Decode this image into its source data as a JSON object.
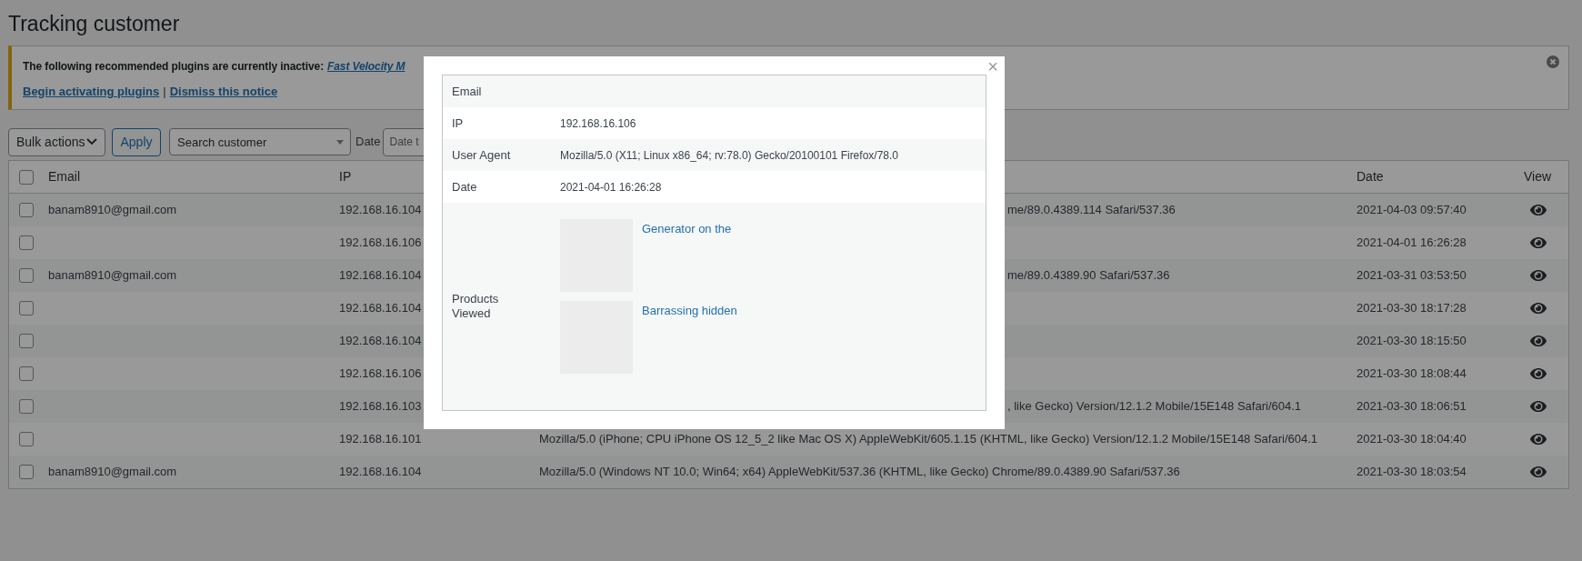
{
  "page_title": "Tracking customer",
  "notice": {
    "text": "The following recommended plugins are currently inactive:",
    "plugin_link": "Fast Velocity M",
    "links": [
      "Begin activating plugins",
      "Dismiss this notice"
    ],
    "separator": "|"
  },
  "toolbar": {
    "bulk_actions": "Bulk actions",
    "apply": "Apply",
    "search": {
      "placeholder": "Search customer"
    },
    "date_label": "Date",
    "date_field": {
      "placeholder": "Date t"
    }
  },
  "table": {
    "select_all_checked": false,
    "columns": {
      "email": "Email",
      "ip": "IP",
      "date": "Date",
      "view": "View"
    },
    "rows": [
      {
        "checked": false,
        "email": "banam8910@gmail.com",
        "ip": "192.168.16.104",
        "user_agent": {
          "kind": "covered",
          "text": "me/89.0.4389.114 Safari/537.36"
        },
        "date": "2021-04-03 09:57:40"
      },
      {
        "checked": false,
        "ip": "192.168.16.106",
        "date": "2021-04-01 16:26:28"
      },
      {
        "checked": false,
        "email": "banam8910@gmail.com",
        "ip": "192.168.16.104",
        "user_agent": {
          "kind": "covered",
          "text": "me/89.0.4389.90 Safari/537.36"
        },
        "date": "2021-03-31 03:53:50"
      },
      {
        "checked": false,
        "ip": "192.168.16.104",
        "date": "2021-03-30 18:17:28"
      },
      {
        "checked": false,
        "ip": "192.168.16.104",
        "date": "2021-03-30 18:15:50"
      },
      {
        "checked": false,
        "ip": "192.168.16.106",
        "date": "2021-03-30 18:08:44"
      },
      {
        "checked": false,
        "ip": "192.168.16.103",
        "user_agent": {
          "kind": "covered",
          "text": ", like Gecko) Version/12.1.2 Mobile/15E148 Safari/604.1"
        },
        "date": "2021-03-30 18:06:51"
      },
      {
        "checked": false,
        "ip": "192.168.16.101",
        "user_agent": {
          "kind": "full",
          "text": "Mozilla/5.0 (iPhone; CPU iPhone OS 12_5_2 like Mac OS X) AppleWebKit/605.1.15 (KHTML, like Gecko) Version/12.1.2 Mobile/15E148 Safari/604.1"
        },
        "date": "2021-03-30 18:04:40"
      },
      {
        "checked": false,
        "email": "banam8910@gmail.com",
        "ip": "192.168.16.104",
        "user_agent": {
          "kind": "full",
          "text": "Mozilla/5.0 (Windows NT 10.0; Win64; x64) AppleWebKit/537.36 (KHTML, like Gecko) Chrome/89.0.4389.90 Safari/537.36"
        },
        "date": "2021-03-30 18:03:54"
      }
    ]
  },
  "modal": {
    "close": "×",
    "details": [
      {
        "label": "Email"
      },
      {
        "label": "IP",
        "value": "192.168.16.106"
      },
      {
        "label": "User Agent",
        "value": "Mozilla/5.0 (X11; Linux x86_64; rv:78.0) Gecko/20100101 Firefox/78.0"
      },
      {
        "label": "Date",
        "value": "2021-04-01 16:26:28"
      }
    ],
    "products_label": "Products Viewed",
    "products": [
      {
        "name": "Generator on the"
      },
      {
        "name": "Barrassing hidden"
      }
    ]
  }
}
